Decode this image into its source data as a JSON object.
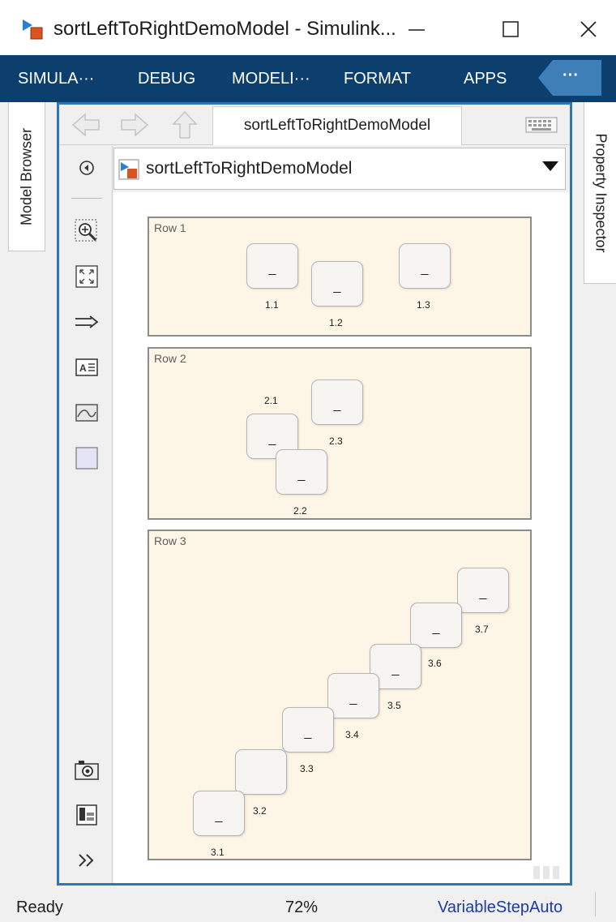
{
  "window": {
    "title": "sortLeftToRightDemoModel - Simulink...",
    "app_icon": "simulink-model-icon",
    "minimize_icon": "minimize-icon",
    "maximize_icon": "maximize-icon",
    "close_icon": "close-icon"
  },
  "toolstrip": {
    "tabs": [
      {
        "label": "SIMULA···"
      },
      {
        "label": "DEBUG"
      },
      {
        "label": "MODELI···"
      },
      {
        "label": "FORMAT"
      },
      {
        "label": "APPS"
      }
    ],
    "more_label": "···",
    "background": "#0c3f6e"
  },
  "side_panels": {
    "left": "Model Browser",
    "right": "Property Inspector"
  },
  "editor": {
    "tab_label": "sortLeftToRightDemoModel",
    "address": "sortLeftToRightDemoModel",
    "accent": "#2e75b6",
    "nav_icons": [
      "back-arrow-icon",
      "forward-arrow-icon",
      "up-arrow-icon",
      "keyboard-icon"
    ],
    "palette_icons": [
      "hide-panel-icon",
      "zoom-icon",
      "fit-to-view-icon",
      "signal-arrow-icon",
      "annotation-icon",
      "image-icon",
      "area-icon",
      "camera-icon",
      "report-icon",
      "more-chevron-icon"
    ]
  },
  "model": {
    "area_color": "#fdf5e6",
    "areas": [
      {
        "label": "Row 1",
        "blocks": [
          {
            "text": "_",
            "name": "1.1"
          },
          {
            "text": "_",
            "name": "1.2"
          },
          {
            "text": "_",
            "name": "1.3"
          }
        ]
      },
      {
        "label": "Row 2",
        "blocks": [
          {
            "text": "_",
            "name": "2.1"
          },
          {
            "text": "_",
            "name": "2.2"
          },
          {
            "text": "_",
            "name": "2.3"
          }
        ]
      },
      {
        "label": "Row 3",
        "blocks": [
          {
            "text": "_",
            "name": "3.1"
          },
          {
            "text": "",
            "name": "3.2"
          },
          {
            "text": "_",
            "name": "3.3"
          },
          {
            "text": "_",
            "name": "3.4"
          },
          {
            "text": "_",
            "name": "3.5"
          },
          {
            "text": "_",
            "name": "3.6"
          },
          {
            "text": "_",
            "name": "3.7"
          }
        ]
      }
    ]
  },
  "status": {
    "state": "Ready",
    "zoom": "72%",
    "solver": "VariableStepAuto",
    "solver_color": "#1a3aa8"
  }
}
